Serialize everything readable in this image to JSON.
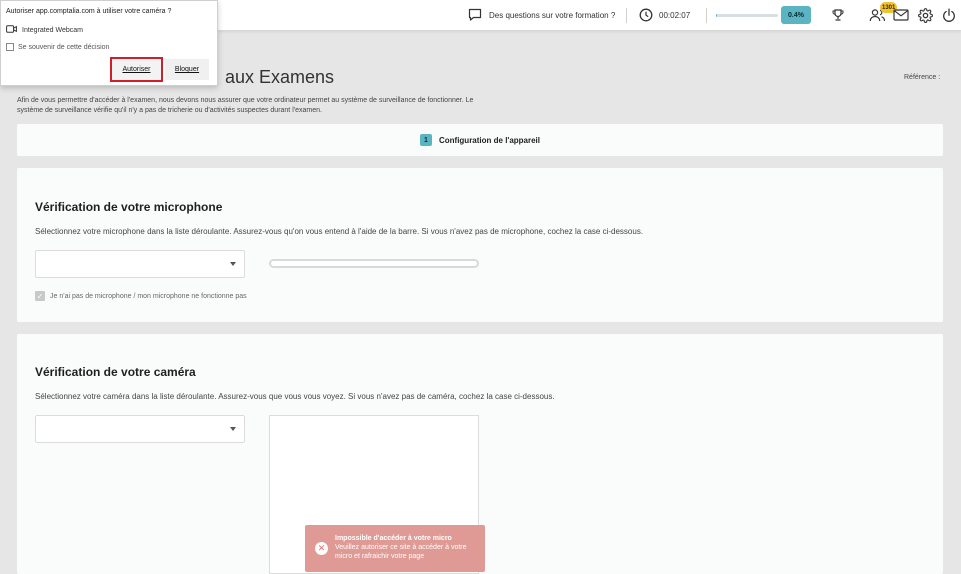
{
  "permission_popup": {
    "title": "Autoriser app.comptalia.com à utiliser votre caméra ?",
    "device": "Integrated Webcam",
    "remember_label": "Se souvenir de cette décision",
    "allow_label": "Autoriser",
    "block_label": "Bloquer"
  },
  "topbar": {
    "questions_label": "Des questions sur votre formation ?",
    "timer": "00:02:07",
    "progress_percent": 0.4,
    "progress_label": "0.4%",
    "notification_count": "1301"
  },
  "page": {
    "title": "aux Examens",
    "reference_label": "Référence :",
    "intro": "Afin de vous permettre d'accéder à l'examen, nous devons nous assurer que votre ordinateur permet au système de surveillance de fonctionner. Le système de surveillance vérifie qu'il n'y a pas de tricherie ou d'activités suspectes durant l'examen.",
    "step": {
      "number": "1",
      "label": "Configuration de l'appareil"
    }
  },
  "microphone": {
    "title": "Vérification de votre microphone",
    "description": "Sélectionnez votre microphone dans la liste déroulante. Assurez-vous qu'on vous entend à l'aide de la barre. Si vous n'avez pas de microphone, cochez la case ci-dessous.",
    "no_mic_label": "Je n'ai pas de microphone / mon microphone ne fonctionne pas"
  },
  "camera": {
    "title": "Vérification de votre caméra",
    "description": "Sélectionnez votre caméra dans la liste déroulante. Assurez-vous que vous vous voyez. Si vous n'avez pas de caméra, cochez la case ci-dessous."
  },
  "toast": {
    "title": "Impossible d'accéder à votre micro",
    "message": "Veuillez autoriser ce site à accéder à votre micro et rafraichir votre page"
  }
}
